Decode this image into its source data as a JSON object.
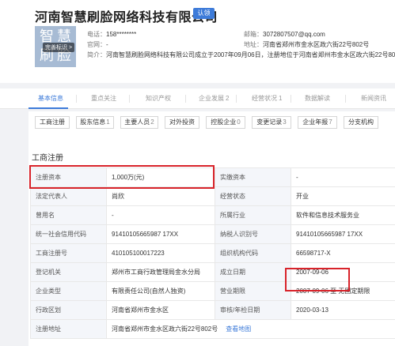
{
  "header": {
    "company_name": "河南智慧刷脸网络科技有限公司",
    "verify_badge": "认领",
    "logo_chars": "智慧刷脸",
    "logo_tag": "完善标识 >",
    "phone_label": "电话：",
    "phone_value": "158********",
    "email_label": "邮箱：",
    "email_value": "3072807507@qq.com",
    "website_label": "官网：",
    "website_value": "-",
    "address_label": "地址：",
    "address_value": "河南省郑州市金水区政六街22号802号",
    "intro_label": "简介：",
    "intro_value": "河南智慧刷脸网络科技有限公司成立于2007年09月06日，注册地位于河南省郑州市金水区政六街22号802号，"
  },
  "tabs": [
    {
      "label": "基本信息",
      "count": "",
      "active": true
    },
    {
      "label": "重点关注",
      "count": ""
    },
    {
      "label": "知识产权",
      "count": ""
    },
    {
      "label": "企业发展",
      "count": "2"
    },
    {
      "label": "经营状况",
      "count": "1"
    },
    {
      "label": "数据解读",
      "count": ""
    },
    {
      "label": "新闻资讯",
      "count": ""
    }
  ],
  "subtabs": [
    {
      "label": "工商注册",
      "count": ""
    },
    {
      "label": "股东信息",
      "count": "1"
    },
    {
      "label": "主要人员",
      "count": "2"
    },
    {
      "label": "对外投资",
      "count": ""
    },
    {
      "label": "控股企业",
      "count": "0"
    },
    {
      "label": "变更记录",
      "count": "3"
    },
    {
      "label": "企业年报",
      "count": "7"
    },
    {
      "label": "分支机构",
      "count": ""
    }
  ],
  "section_title": "工商注册",
  "table": [
    {
      "k1": "注册资本",
      "v1": "1,000万(元)",
      "k2": "实缴资本",
      "v2": "-"
    },
    {
      "k1": "法定代表人",
      "v1": "尚欣",
      "k2": "经营状态",
      "v2": "开业"
    },
    {
      "k1": "曾用名",
      "v1": "-",
      "k2": "所属行业",
      "v2": "软件和信息技术服务业"
    },
    {
      "k1": "统一社会信用代码",
      "v1": "91410105665987 17XX",
      "k2": "纳税人识别号",
      "v2": "91410105665987 17XX"
    },
    {
      "k1": "工商注册号",
      "v1": "410105100017223",
      "k2": "组织机构代码",
      "v2": "66598717-X"
    },
    {
      "k1": "登记机关",
      "v1": "郑州市工商行政管理局金水分局",
      "k2": "成立日期",
      "v2": "2007-09-06"
    },
    {
      "k1": "企业类型",
      "v1": "有限责任公司(自然人独资)",
      "k2": "营业期限",
      "v2": "2007-09-06 至 无固定期限"
    },
    {
      "k1": "行政区划",
      "v1": "河南省郑州市金水区",
      "k2": "审核/年检日期",
      "v2": "2020-03-13"
    },
    {
      "k1": "注册地址",
      "v1": "河南省郑州市金水区政六街22号802号",
      "k2": "",
      "v2": ""
    }
  ],
  "map_link": "查看地图",
  "colors": {
    "accent": "#3d7bd9",
    "highlight": "#d8232a",
    "key_bg": "#f4f6fa"
  }
}
